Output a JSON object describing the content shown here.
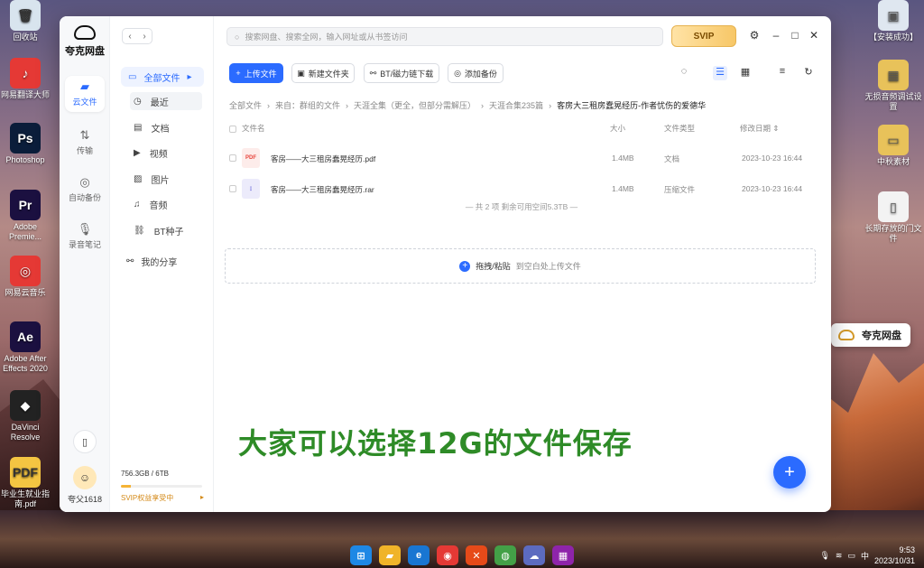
{
  "desktop": {
    "left_icons": [
      {
        "label": "回收站",
        "glyph": "🗑",
        "color": "#d8e4ee"
      },
      {
        "label": "网易翻译大师",
        "glyph": "♪",
        "color": "#e53935"
      },
      {
        "label": "Photoshop",
        "glyph": "Ps",
        "color": "#0b1d3a"
      },
      {
        "label": "Adobe Premie...",
        "glyph": "Pr",
        "color": "#1b1040"
      },
      {
        "label": "网易云音乐",
        "glyph": "◎",
        "color": "#e53935"
      },
      {
        "label": "Adobe After Effects 2020",
        "glyph": "Ae",
        "color": "#1b1040"
      },
      {
        "label": "DaVinci Resolve",
        "glyph": "◆",
        "color": "#222"
      },
      {
        "label": "毕业生就业指南.pdf",
        "glyph": "PDF",
        "color": "#f4c542"
      }
    ],
    "right_icons": [
      {
        "label": "【安装成功】",
        "glyph": "▣",
        "color": "#dfe7f0"
      },
      {
        "label": "无损音频调试设置",
        "glyph": "▦",
        "color": "#e8c25a"
      },
      {
        "label": "中秋素材",
        "glyph": "▭",
        "color": "#e8c25a"
      },
      {
        "label": "长期存放的门文件",
        "glyph": "▯",
        "color": "#f3f3f3"
      }
    ],
    "float_widget": "夸克网盘"
  },
  "app": {
    "name": "夸克网盘",
    "search_placeholder": "搜索网盘、搜索全网，输入网址或从书签访问",
    "svip_label": "SVIP",
    "rail": [
      {
        "label": "云文件",
        "icon": "folder-icon",
        "glyph": "▰",
        "active": true
      },
      {
        "label": "传输",
        "icon": "transfer-icon",
        "glyph": "⇅",
        "active": false
      },
      {
        "label": "自动备份",
        "icon": "backup-icon",
        "glyph": "◎",
        "active": false
      },
      {
        "label": "录音笔记",
        "icon": "mic-icon",
        "glyph": "🎙",
        "active": false
      }
    ],
    "user": {
      "name": "夸父1618"
    },
    "nav": {
      "all_files": "全部文件",
      "items": [
        {
          "label": "最近",
          "glyph": "◷"
        },
        {
          "label": "文档",
          "glyph": "▤"
        },
        {
          "label": "视频",
          "glyph": "▶"
        },
        {
          "label": "图片",
          "glyph": "▨"
        },
        {
          "label": "音频",
          "glyph": "♫"
        },
        {
          "label": "BT种子",
          "glyph": "⛓"
        }
      ],
      "share": "我的分享"
    },
    "storage": {
      "text": "756.3GB / 6TB",
      "used_fraction": 0.123,
      "tip": "SVIP权益享受中",
      "tip_arrow": "▸"
    },
    "toolbar": {
      "upload": "上传文件",
      "new_folder": "新建文件夹",
      "bt_download": "BT/磁力链下载",
      "add_backup": "添加备份"
    },
    "breadcrumb": [
      "全部文件",
      "来自：群组的文件",
      "天涯全集（更全，但部分需解压）",
      "天涯合集235篇",
      "客房大三租房蠢晃经历-作者忧伤的爱德华"
    ],
    "columns": {
      "name": "文件名",
      "size": "大小",
      "type": "文件类型",
      "date": "修改日期"
    },
    "files": [
      {
        "name": "客房——大三租房蠢晃经历.pdf",
        "size": "1.4MB",
        "type": "文档",
        "date": "2023-10-23 16:44",
        "badge": "PDF",
        "badge_color": "#e8453c",
        "badge_bg": "#fdecea"
      },
      {
        "name": "客房——大三租房蠢晃经历.rar",
        "size": "1.4MB",
        "type": "压缩文件",
        "date": "2023-10-23 16:44",
        "badge": "⋮",
        "badge_color": "#5b5bd6",
        "badge_bg": "#ecebfb"
      }
    ],
    "summary": "— 共 2 项 剩余可用空间5.3TB —",
    "dropzone": {
      "main": "拖拽/粘贴",
      "hint": "到空白处上传文件"
    },
    "fab": "+"
  },
  "caption": "大家可以选择12G的文件保存",
  "taskbar": {
    "icons": [
      {
        "name": "start-icon",
        "glyph": "⊞",
        "color": "#1e88e5"
      },
      {
        "name": "explorer-icon",
        "glyph": "▰",
        "color": "#f0b429"
      },
      {
        "name": "edge-icon",
        "glyph": "e",
        "color": "#1976d2"
      },
      {
        "name": "chrome-icon",
        "glyph": "◉",
        "color": "#e53935"
      },
      {
        "name": "app-x-icon",
        "glyph": "✕",
        "color": "#e64a19"
      },
      {
        "name": "wechat-icon",
        "glyph": "◍",
        "color": "#43a047"
      },
      {
        "name": "quark-icon",
        "glyph": "☁",
        "color": "#5c6bc0"
      },
      {
        "name": "photos-icon",
        "glyph": "▦",
        "color": "#8e24aa"
      }
    ],
    "tray": {
      "ime": "中",
      "time": "9:53",
      "date": "2023/10/31"
    }
  }
}
